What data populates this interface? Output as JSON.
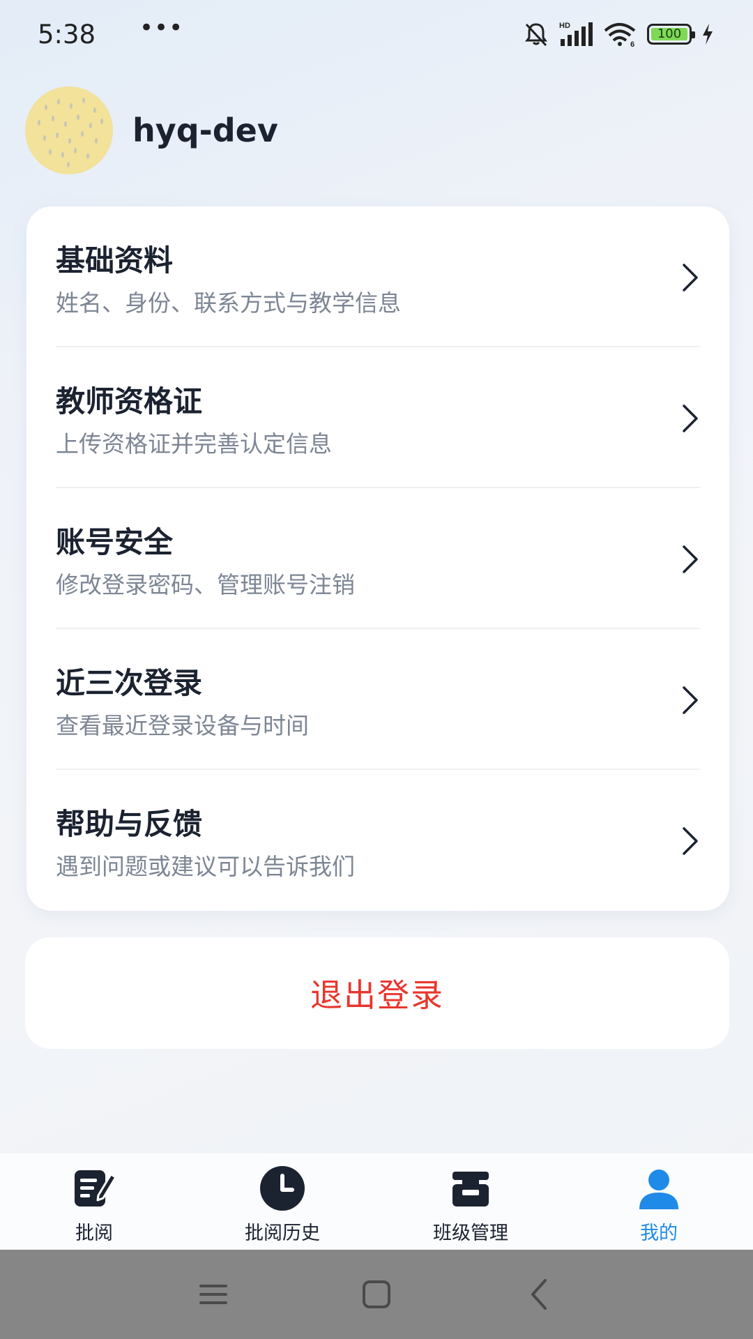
{
  "status": {
    "time": "5:38",
    "dots": "•••",
    "battery": "100",
    "network": "HD",
    "wifi_band": "6"
  },
  "profile": {
    "username": "hyq-dev"
  },
  "menu": [
    {
      "title": "基础资料",
      "subtitle": "姓名、身份、联系方式与教学信息"
    },
    {
      "title": "教师资格证",
      "subtitle": "上传资格证并完善认定信息"
    },
    {
      "title": "账号安全",
      "subtitle": "修改登录密码、管理账号注销"
    },
    {
      "title": "近三次登录",
      "subtitle": "查看最近登录设备与时间"
    },
    {
      "title": "帮助与反馈",
      "subtitle": "遇到问题或建议可以告诉我们"
    }
  ],
  "logout": {
    "label": "退出登录"
  },
  "tabs": [
    {
      "label": "批阅",
      "icon": "edit-document-icon"
    },
    {
      "label": "批阅历史",
      "icon": "clock-icon"
    },
    {
      "label": "班级管理",
      "icon": "class-box-icon"
    },
    {
      "label": "我的",
      "icon": "user-icon",
      "active": true
    }
  ],
  "colors": {
    "accent": "#1f8ae8",
    "danger": "#e8362d",
    "battery": "#7ed957"
  }
}
